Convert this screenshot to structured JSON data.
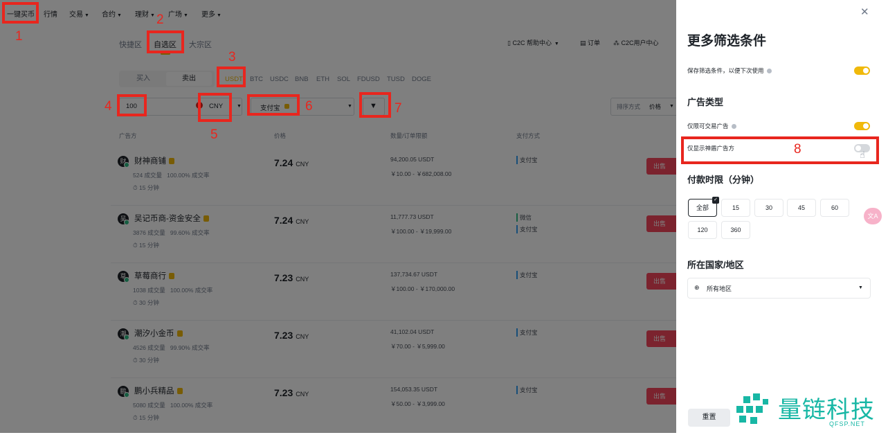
{
  "nav": {
    "items": [
      "一键买币",
      "行情",
      "交易",
      "合约",
      "理财",
      "广场",
      "更多"
    ]
  },
  "zones": [
    "快捷区",
    "自选区",
    "大宗区"
  ],
  "header_right": {
    "help": "C2C 帮助中心",
    "orders": "订单",
    "user_center": "C2C用户中心"
  },
  "side_tabs": {
    "buy": "买入",
    "sell": "卖出"
  },
  "coins": [
    "USDT",
    "BTC",
    "USDC",
    "BNB",
    "ETH",
    "SOL",
    "FDUSD",
    "TUSD",
    "DOGE"
  ],
  "filters": {
    "amount": "100",
    "currency": "CNY",
    "payment": "支付宝",
    "sort_label": "排序方式",
    "sort_value": "价格"
  },
  "table": {
    "headers": [
      "广告方",
      "价格",
      "数量/订单限额",
      "支付方式"
    ],
    "buy_label": "出售",
    "rows": [
      {
        "avatar": "财",
        "name": "财神商铺",
        "orders": "524 成交量",
        "rate": "100.00% 成交率",
        "time": "15 分钟",
        "price": "7.24",
        "cur": "CNY",
        "qty": "94,200.05 USDT",
        "limit": "￥10.00 - ￥682,008.00",
        "pay": [
          "支付宝"
        ]
      },
      {
        "avatar": "吴",
        "name": "吴记币商-资金安全",
        "orders": "3876 成交量",
        "rate": "99.60% 成交率",
        "time": "15 分钟",
        "price": "7.24",
        "cur": "CNY",
        "qty": "11,777.73 USDT",
        "limit": "￥100.00 - ￥19,999.00",
        "pay": [
          "微信",
          "支付宝"
        ]
      },
      {
        "avatar": "草",
        "name": "草莓商行",
        "orders": "1038 成交量",
        "rate": "100.00% 成交率",
        "time": "30 分钟",
        "price": "7.23",
        "cur": "CNY",
        "qty": "137,734.67 USDT",
        "limit": "￥100.00 - ￥170,000.00",
        "pay": [
          "支付宝"
        ]
      },
      {
        "avatar": "潮",
        "name": "潮汐小金币",
        "orders": "4526 成交量",
        "rate": "99.90% 成交率",
        "time": "30 分钟",
        "price": "7.23",
        "cur": "CNY",
        "qty": "41,102.04 USDT",
        "limit": "￥70.00 - ￥5,999.00",
        "pay": [
          "支付宝"
        ]
      },
      {
        "avatar": "鹏",
        "name": "鹏小兵精品",
        "orders": "5080 成交量",
        "rate": "100.00% 成交率",
        "time": "15 分钟",
        "price": "7.23",
        "cur": "CNY",
        "qty": "154,053.35 USDT",
        "limit": "￥50.00 - ￥3,999.00",
        "pay": [
          "支付宝"
        ]
      }
    ]
  },
  "annotations": [
    "1",
    "2",
    "3",
    "4",
    "5",
    "6",
    "7",
    "8"
  ],
  "panel": {
    "title": "更多筛选条件",
    "save_filter": "保存筛选条件，以便下次使用",
    "ad_type": "广告类型",
    "only_tradable": "仅限可交易广告",
    "only_verified": "仅显示神盾广告方",
    "pay_limit": "付款时限（分钟）",
    "time_options": [
      "全部",
      "15",
      "30",
      "45",
      "60",
      "120",
      "360"
    ],
    "region_title": "所在国家/地区",
    "region_value": "所有地区",
    "reset": "重置"
  },
  "watermark": {
    "text": "量链科技",
    "url": "QFSP.NET"
  },
  "colors": {
    "accent": "#f0b90b",
    "sell": "#f6465d",
    "annotation": "#e8261e",
    "watermark": "#18b7a5"
  }
}
